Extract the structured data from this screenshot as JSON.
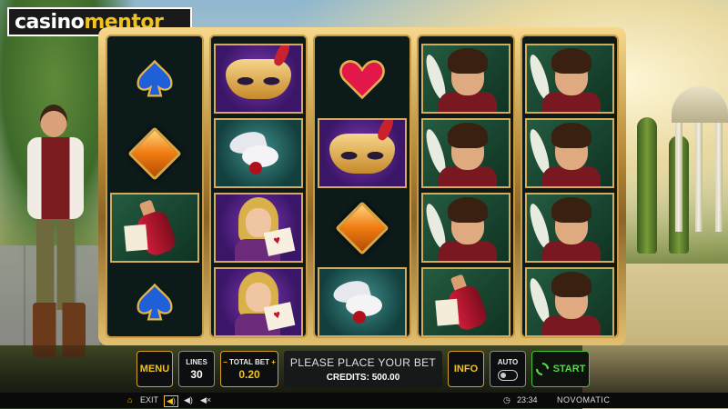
{
  "logo": {
    "part1": "casino",
    "part2": "mentor"
  },
  "reels": [
    [
      "blue-spade",
      "blue-spade",
      "diamond-orange",
      "potion-bottle",
      "blue-spade"
    ],
    [
      "venetian-mask",
      "dove-with-rose",
      "juliet-with-letter",
      "juliet-with-letter"
    ],
    [
      "ruby-heart",
      "venetian-mask",
      "diamond-orange",
      "dove-with-rose"
    ],
    [
      "romeo",
      "romeo",
      "romeo",
      "potion-bottle"
    ],
    [
      "romeo",
      "romeo",
      "romeo",
      "romeo"
    ]
  ],
  "controls": {
    "menu": "MENU",
    "lines_label": "LINES",
    "lines_value": "30",
    "total_bet_label": "TOTAL BET",
    "total_bet_value": "0.20",
    "minus": "−",
    "plus": "+",
    "message": "PLEASE PLACE YOUR BET",
    "credits": "CREDITS: 500.00",
    "info": "INFO",
    "auto": "AUTO",
    "start": "START"
  },
  "bottom_bar": {
    "exit": "EXIT",
    "time": "23:34",
    "brand": "NOVOMATIC"
  },
  "colors": {
    "gold": "#f2c31a",
    "start_green": "#56d64a"
  }
}
